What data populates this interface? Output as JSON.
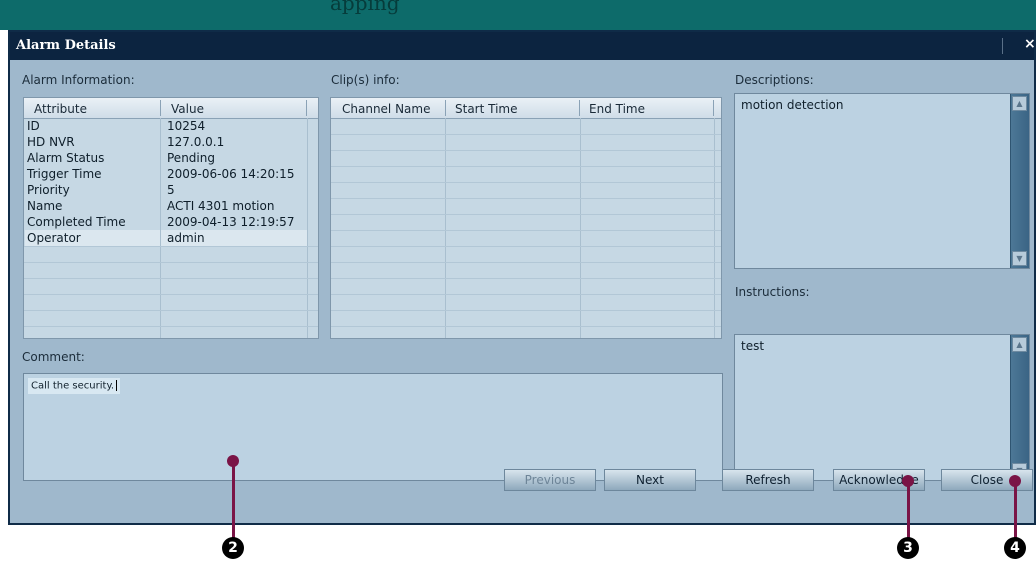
{
  "page_header": "apping",
  "dialog": {
    "title": "Alarm Details",
    "close_glyph": "×"
  },
  "alarm_info": {
    "label": "Alarm Information:",
    "columns": [
      "Attribute",
      "Value"
    ],
    "rows": [
      [
        "ID",
        "10254"
      ],
      [
        "HD NVR",
        "127.0.0.1"
      ],
      [
        "Alarm Status",
        "Pending"
      ],
      [
        "Trigger Time",
        "2009-06-06 14:20:15"
      ],
      [
        "Priority",
        "5"
      ],
      [
        "Name",
        "ACTI 4301 motion"
      ],
      [
        "Completed Time",
        "2009-04-13 12:19:57"
      ],
      [
        "Operator",
        "admin"
      ]
    ]
  },
  "clips": {
    "label": "Clip(s) info:",
    "columns": [
      "Channel Name",
      "Start Time",
      "End Time"
    ]
  },
  "descriptions": {
    "label": "Descriptions:",
    "text": "motion detection"
  },
  "instructions": {
    "label": "Instructions:",
    "text": "test"
  },
  "comment": {
    "label": "Comment:",
    "value": "Call the security."
  },
  "buttons": {
    "previous": "Previous",
    "next": "Next",
    "refresh": "Refresh",
    "acknowledge": "Acknowledge",
    "close": "Close"
  },
  "callouts": [
    "2",
    "3",
    "4"
  ],
  "colors": {
    "dialog_bg": "#9fb8cc",
    "titlebar": "#0c2440",
    "callout": "#7a1446"
  }
}
